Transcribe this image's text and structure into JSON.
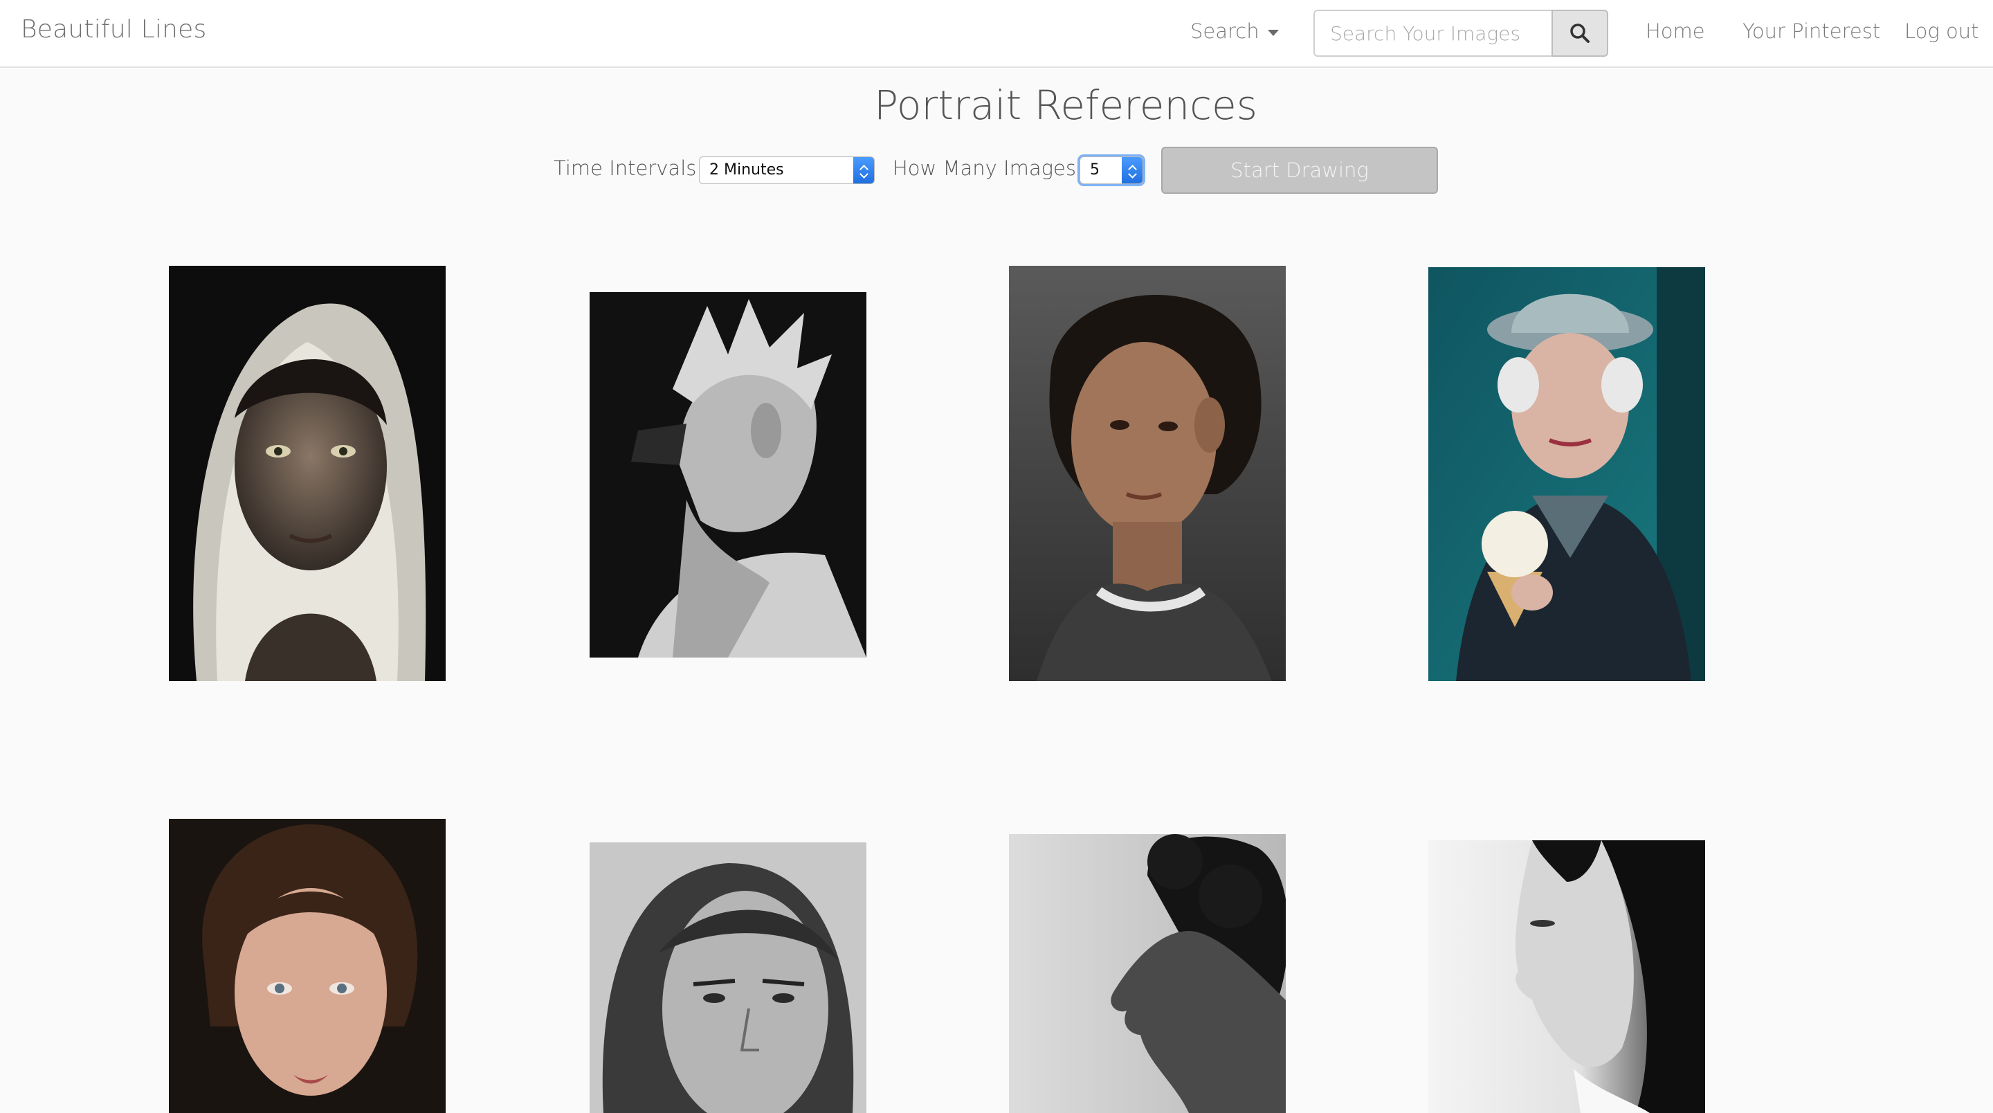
{
  "navbar": {
    "brand": "Beautiful Lines",
    "search_dropdown": "Search",
    "search_placeholder": "Search Your Images",
    "links": [
      "Home",
      "Your Pinterest",
      "Log out"
    ]
  },
  "page": {
    "title": "Portrait References"
  },
  "controls": {
    "time_label": "Time Intervals:",
    "time_value": "2 Minutes",
    "count_label": "How Many Images:",
    "count_value": "5",
    "start_button": "Start Drawing"
  },
  "colors": {
    "accent": "#1f6fe0",
    "button_disabled": "#c4c4c4"
  },
  "images": [
    {
      "name": "portrait-headscarf-woman"
    },
    {
      "name": "portrait-screaming-man"
    },
    {
      "name": "portrait-curly-hair-woman"
    },
    {
      "name": "portrait-elderly-woman-ice-cream"
    },
    {
      "name": "portrait-woman-freckles"
    },
    {
      "name": "portrait-woman-bw-frown"
    },
    {
      "name": "portrait-profile-curly"
    },
    {
      "name": "portrait-asian-woman-profile"
    }
  ]
}
